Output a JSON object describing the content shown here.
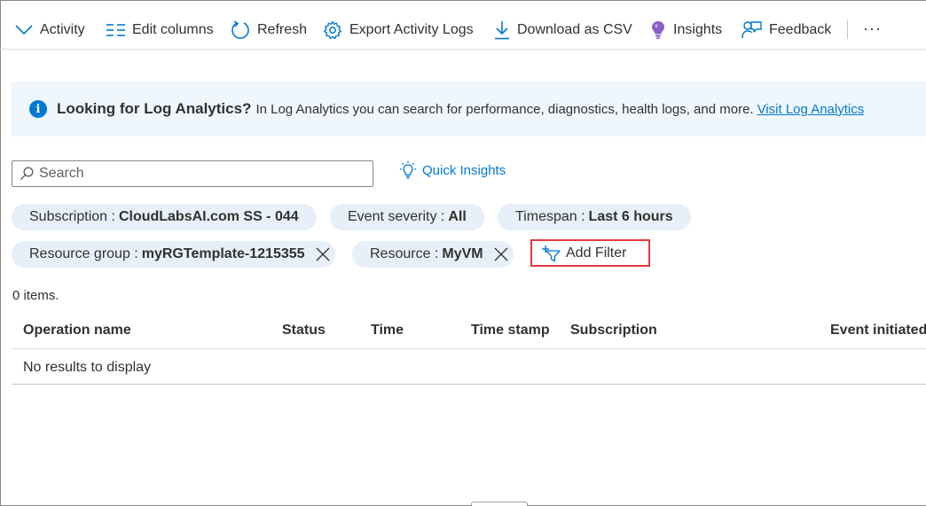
{
  "toolbar": {
    "items": [
      {
        "label": "Activity",
        "icon": "chevron-down-icon"
      },
      {
        "label": "Edit columns",
        "icon": "edit-columns-icon"
      },
      {
        "label": "Refresh",
        "icon": "refresh-icon"
      },
      {
        "label": "Export Activity Logs",
        "icon": "gear-icon"
      },
      {
        "label": "Download as CSV",
        "icon": "download-icon"
      },
      {
        "label": "Insights",
        "icon": "lightbulb-icon"
      },
      {
        "label": "Feedback",
        "icon": "feedback-icon"
      }
    ],
    "more": "···"
  },
  "banner": {
    "icon": "info-icon",
    "title": "Looking for Log Analytics?",
    "text": "In Log Analytics you can search for performance, diagnostics, health logs, and more.",
    "link": "Visit Log Analytics"
  },
  "search": {
    "placeholder": "Search",
    "value": ""
  },
  "quick_insights": {
    "label": "Quick Insights",
    "icon": "lightbulb-outline-icon"
  },
  "filters": [
    {
      "key": "Subscription :",
      "value": "CloudLabsAI.com SS - 044",
      "removable": false
    },
    {
      "key": "Event severity :",
      "value": "All",
      "removable": false
    },
    {
      "key": "Timespan :",
      "value": "Last 6 hours",
      "removable": false
    },
    {
      "key": "Resource group :",
      "value": "myRGTemplate-1215355",
      "removable": true
    },
    {
      "key": "Resource :",
      "value": "MyVM",
      "removable": true
    }
  ],
  "add_filter": {
    "label": "Add Filter",
    "icon": "add-filter-icon"
  },
  "item_count": "0 items.",
  "table": {
    "columns": [
      "Operation name",
      "Status",
      "Time",
      "Time stamp",
      "Subscription",
      "Event initiated"
    ],
    "empty_message": "No results to display"
  },
  "colors": {
    "accent": "#0078d4",
    "pill_bg": "#e7eff8",
    "banner_bg": "#eff6fc",
    "highlight_border": "#e23c3c",
    "insights_purple": "#8661c5"
  }
}
